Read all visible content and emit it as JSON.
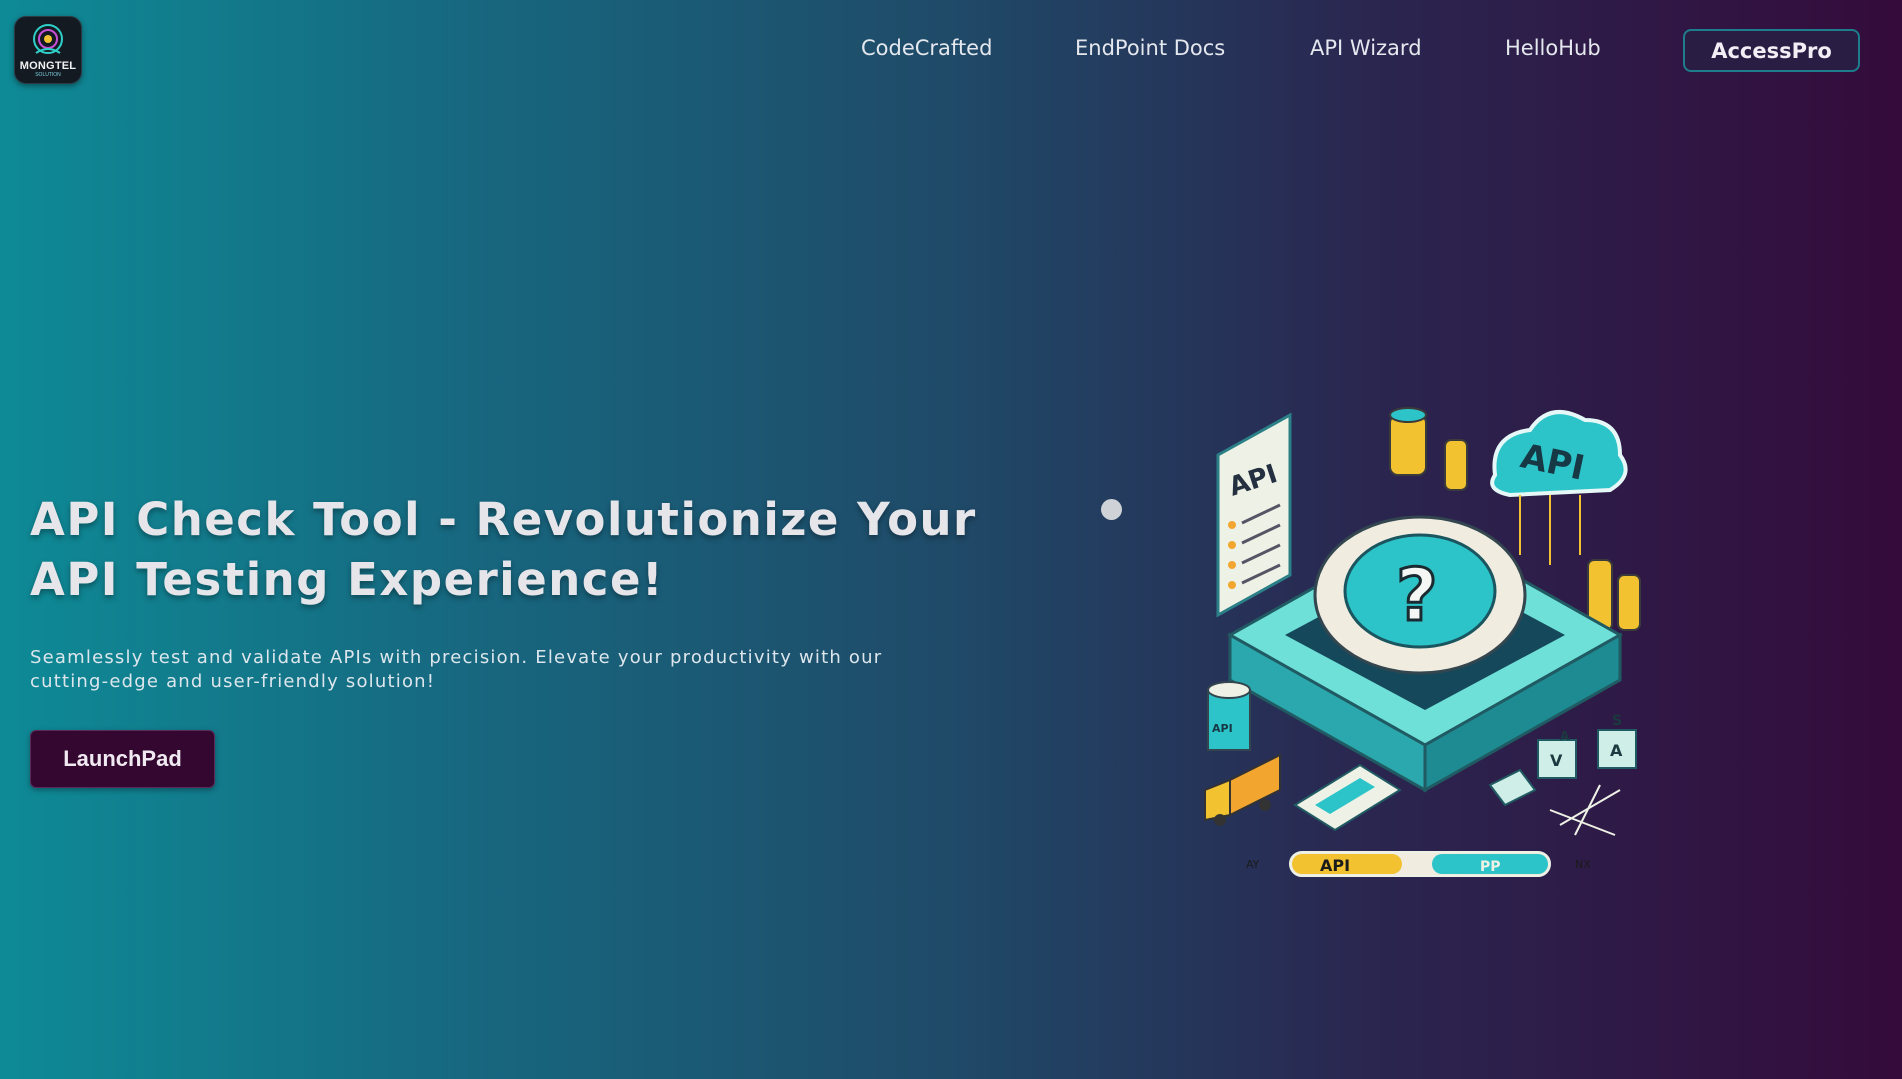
{
  "logo": {
    "text": "MONGTEL",
    "subtext": "SOLUTION"
  },
  "nav": {
    "links": [
      {
        "label": "CodeCrafted"
      },
      {
        "label": "EndPoint Docs"
      },
      {
        "label": "API Wizard"
      },
      {
        "label": "HelloHub"
      }
    ],
    "cta_label": "AccessPro"
  },
  "hero": {
    "title": "API Check Tool - Revolutionize Your API Testing Experience!",
    "subtitle": "Seamlessly test and validate APIs with precision. Elevate your productivity with our cutting-edge and user-friendly solution!",
    "button_label": "LaunchPad"
  },
  "illustration": {
    "labels": {
      "document": "API",
      "cloud": "API",
      "database": "API",
      "bar_left": "API",
      "bar_right": "PP",
      "tick_left": "AY",
      "tick_right": "NX",
      "cube_1": "V",
      "cube_2": "A",
      "cube_3": "S",
      "cube_4": "A"
    }
  },
  "colors": {
    "gradient_start": "#0e8a96",
    "gradient_end": "#340b3b",
    "button_bg": "#33072f",
    "accent_teal": "#2cc4c8",
    "accent_yellow": "#f2c230"
  }
}
